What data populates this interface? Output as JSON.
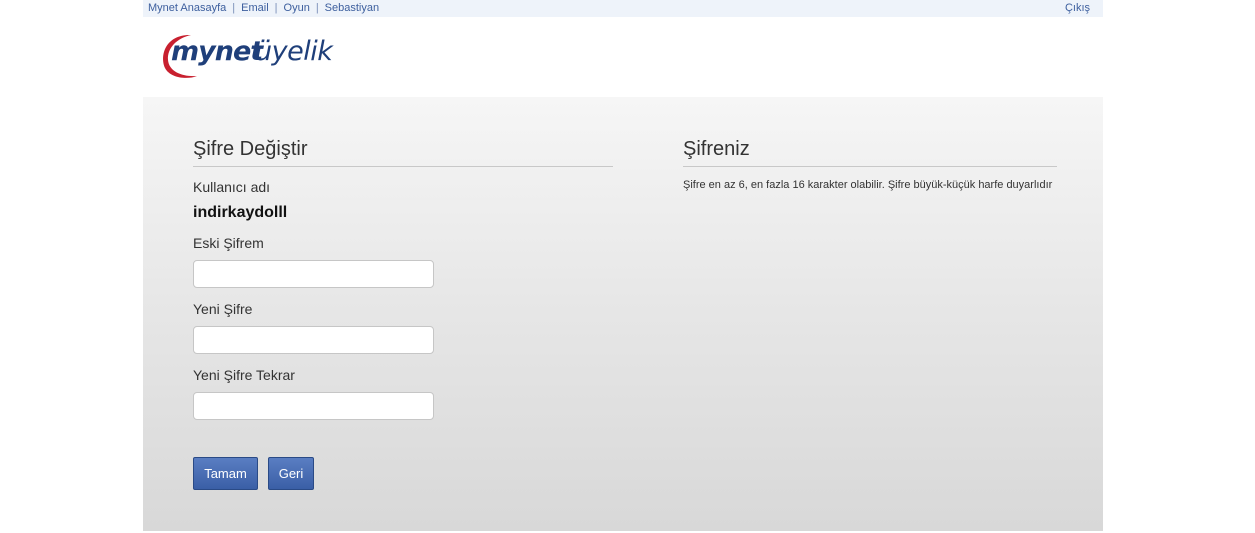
{
  "topbar": {
    "links": [
      "Mynet Anasayfa",
      "Email",
      "Oyun",
      "Sebastiyan"
    ],
    "logout": "Çıkış"
  },
  "logo": {
    "brand": "mynet",
    "sub": "üyelik",
    "colors": {
      "brand": "#1f3f7a",
      "swoosh": "#c8202f"
    }
  },
  "form": {
    "title": "Şifre Değiştir",
    "username_label": "Kullanıcı adı",
    "username_value": "indirkaydolll",
    "old_password_label": "Eski Şifrem",
    "old_password_value": "",
    "new_password_label": "Yeni Şifre",
    "new_password_value": "",
    "repeat_password_label": "Yeni Şifre Tekrar",
    "repeat_password_value": "",
    "submit_label": "Tamam",
    "back_label": "Geri"
  },
  "info": {
    "title": "Şifreniz",
    "text": "Şifre en az 6, en fazla 16 karakter olabilir. Şifre büyük-küçük harfe duyarlıdır"
  },
  "colors": {
    "accent": "#3a5fa6",
    "link": "#3d5f9e"
  }
}
